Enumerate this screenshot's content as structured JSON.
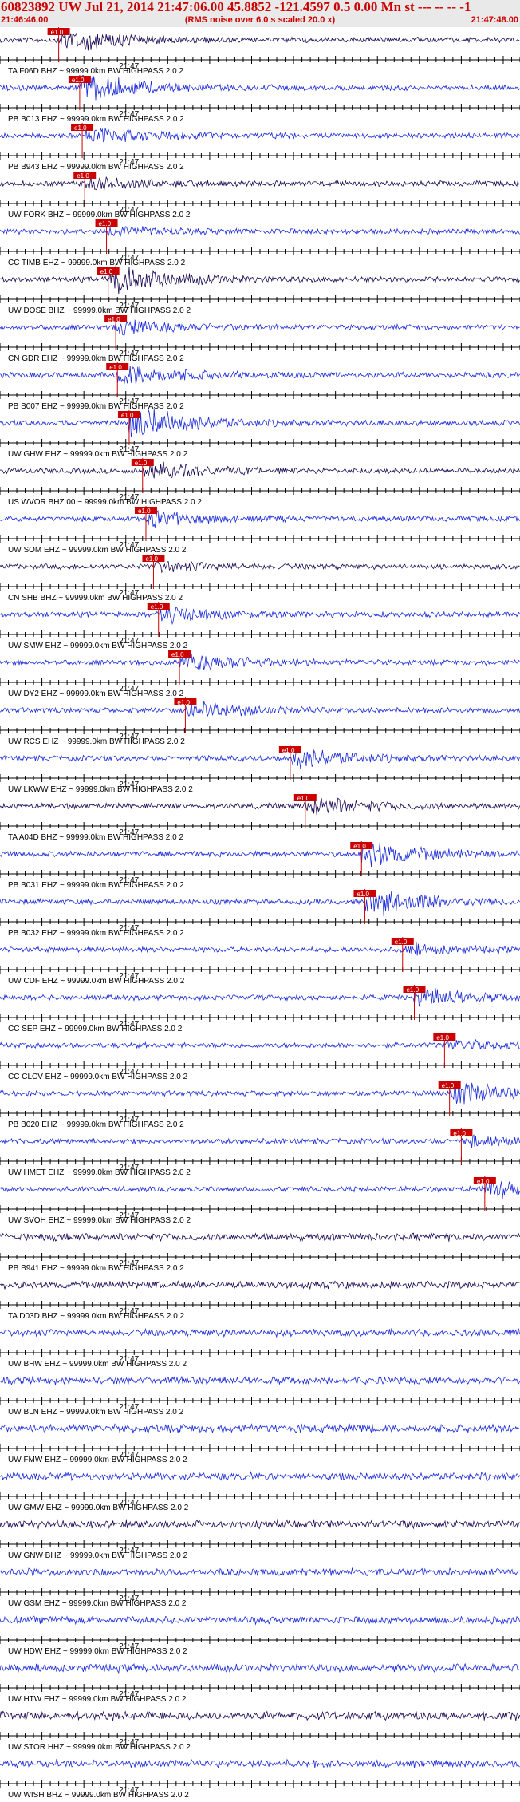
{
  "header": {
    "title": "60823892 UW Jul 21, 2014 21:47:06.00   45.8852  -121.4597  0.5 0.00 Mn st --- -- --   -1",
    "left_time": "21:46:46.00",
    "subtitle": "(RMS noise over 6.0 s scaled 20.0 x)",
    "right_time": "21:47:48.00"
  },
  "chart_data": {
    "type": "line",
    "title": "60823892 UW Jul 21, 2014 21:47:06.00   45.8852  -121.4597  0.5 0.00 Mn st --- -- --   -1",
    "x_range": [
      "21:46:46.00",
      "21:47:48.00"
    ],
    "x_tick_label": "21:47",
    "pick_label": "e1.0",
    "channel_suffix": "~ 99999.0km BW  HIGHPASS  2.0  2",
    "colors": {
      "dark": "#1a0a55",
      "blue": "#1a2ad8",
      "pick": "#cc0000",
      "axis": "#000000"
    },
    "traces": [
      {
        "station": "TA F06D BHZ",
        "color": "dark",
        "pick_s": 7.0,
        "amp": 0.75
      },
      {
        "station": "PB B013 EHZ",
        "color": "blue",
        "pick_s": 9.5,
        "amp": 0.85
      },
      {
        "station": "PB B943 EHZ",
        "color": "blue",
        "pick_s": 9.8,
        "amp": 0.55
      },
      {
        "station": "UW FORK BHZ",
        "color": "dark",
        "pick_s": 10.1,
        "amp": 0.35
      },
      {
        "station": "CC TIMB EHZ",
        "color": "blue",
        "pick_s": 12.7,
        "amp": 0.3
      },
      {
        "station": "UW DOSE BHZ",
        "color": "dark",
        "pick_s": 12.9,
        "amp": 1.0
      },
      {
        "station": "CN GDR EHZ",
        "color": "blue",
        "pick_s": 13.8,
        "amp": 0.5
      },
      {
        "station": "PB B007 EHZ",
        "color": "blue",
        "pick_s": 14.0,
        "amp": 0.75
      },
      {
        "station": "UW GHW EHZ",
        "color": "blue",
        "pick_s": 15.4,
        "amp": 1.0
      },
      {
        "station": "US WVOR BHZ 00",
        "color": "dark",
        "pick_s": 17.0,
        "amp": 0.55
      },
      {
        "station": "UW SOM EHZ",
        "color": "blue",
        "pick_s": 17.4,
        "amp": 0.45
      },
      {
        "station": "CN SHB BHZ",
        "color": "dark",
        "pick_s": 18.3,
        "amp": 0.3
      },
      {
        "station": "UW SMW EHZ",
        "color": "blue",
        "pick_s": 18.9,
        "amp": 0.5
      },
      {
        "station": "UW DY2 EHZ",
        "color": "blue",
        "pick_s": 21.4,
        "amp": 0.6
      },
      {
        "station": "UW RCS EHZ",
        "color": "blue",
        "pick_s": 22.1,
        "amp": 0.55
      },
      {
        "station": "UW LKWW EHZ",
        "color": "blue",
        "pick_s": 34.6,
        "amp": 0.6
      },
      {
        "station": "TA A04D BHZ",
        "color": "dark",
        "pick_s": 36.4,
        "amp": 0.55
      },
      {
        "station": "PB B031 EHZ",
        "color": "blue",
        "pick_s": 43.1,
        "amp": 0.85
      },
      {
        "station": "PB B032 EHZ",
        "color": "blue",
        "pick_s": 43.5,
        "amp": 0.9
      },
      {
        "station": "UW CDF EHZ",
        "color": "blue",
        "pick_s": 48.0,
        "amp": 0.3
      },
      {
        "station": "CC SEP EHZ",
        "color": "blue",
        "pick_s": 49.4,
        "amp": 0.5
      },
      {
        "station": "CC CLCV EHZ",
        "color": "blue",
        "pick_s": 53.0,
        "amp": 0.3
      },
      {
        "station": "PB B020 EHZ",
        "color": "blue",
        "pick_s": 53.6,
        "amp": 0.75
      },
      {
        "station": "UW HMET EHZ",
        "color": "blue",
        "pick_s": 55.0,
        "amp": 0.3
      },
      {
        "station": "UW SVOH EHZ",
        "color": "blue",
        "pick_s": 57.8,
        "amp": 0.55
      },
      {
        "station": "PB B941 EHZ",
        "color": "dark",
        "pick_s": null,
        "amp": 0.35
      },
      {
        "station": "TA D03D BHZ",
        "color": "dark",
        "pick_s": null,
        "amp": 0.35
      },
      {
        "station": "UW BHW EHZ",
        "color": "blue",
        "pick_s": null,
        "amp": 0.3
      },
      {
        "station": "UW BLN EHZ",
        "color": "blue",
        "pick_s": null,
        "amp": 0.35
      },
      {
        "station": "UW FMW EHZ",
        "color": "blue",
        "pick_s": null,
        "amp": 0.5
      },
      {
        "station": "UW GMW EHZ",
        "color": "blue",
        "pick_s": null,
        "amp": 0.35
      },
      {
        "station": "UW GNW BHZ",
        "color": "dark",
        "pick_s": null,
        "amp": 0.4
      },
      {
        "station": "UW GSM EHZ",
        "color": "blue",
        "pick_s": null,
        "amp": 0.35
      },
      {
        "station": "UW HDW EHZ",
        "color": "blue",
        "pick_s": null,
        "amp": 0.35
      },
      {
        "station": "UW HTW EHZ",
        "color": "blue",
        "pick_s": null,
        "amp": 0.45
      },
      {
        "station": "UW STOR HHZ",
        "color": "dark",
        "pick_s": null,
        "amp": 0.5
      },
      {
        "station": "UW WISH BHZ",
        "color": "blue",
        "pick_s": null,
        "amp": 0.35
      }
    ]
  }
}
